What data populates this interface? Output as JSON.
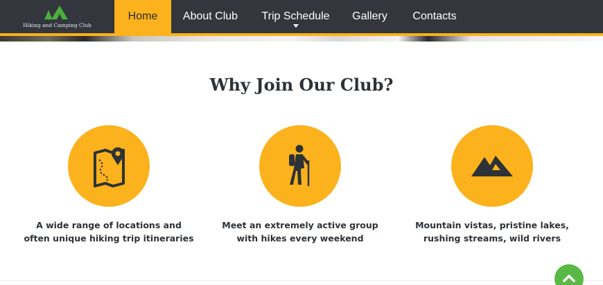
{
  "site": {
    "logo_text": "Hiking and Camping Club",
    "logo_icon": "tents-trees-logo-icon"
  },
  "nav": {
    "items": [
      {
        "label": "Home",
        "active": true
      },
      {
        "label": "About Club",
        "active": false
      },
      {
        "label": "Trip Schedule",
        "active": false,
        "has_dropdown": true
      },
      {
        "label": "Gallery",
        "active": false
      },
      {
        "label": "Contacts",
        "active": false
      }
    ]
  },
  "section": {
    "title": "Why Join Our Club?"
  },
  "features": [
    {
      "icon": "map-pin-icon",
      "text": "A wide range of locations and often unique hiking trip itineraries"
    },
    {
      "icon": "hiker-icon",
      "text": "Meet an extremely active group with hikes every weekend"
    },
    {
      "icon": "mountains-icon",
      "text": "Mountain vistas, pristine lakes, rushing streams, wild rivers"
    }
  ],
  "back_to_top": {
    "icon": "chevron-up-icon"
  },
  "colors": {
    "nav_bg": "#33373d",
    "accent": "#fbb21c",
    "text_dark": "#2d3236",
    "back_to_top": "#5ab946"
  }
}
